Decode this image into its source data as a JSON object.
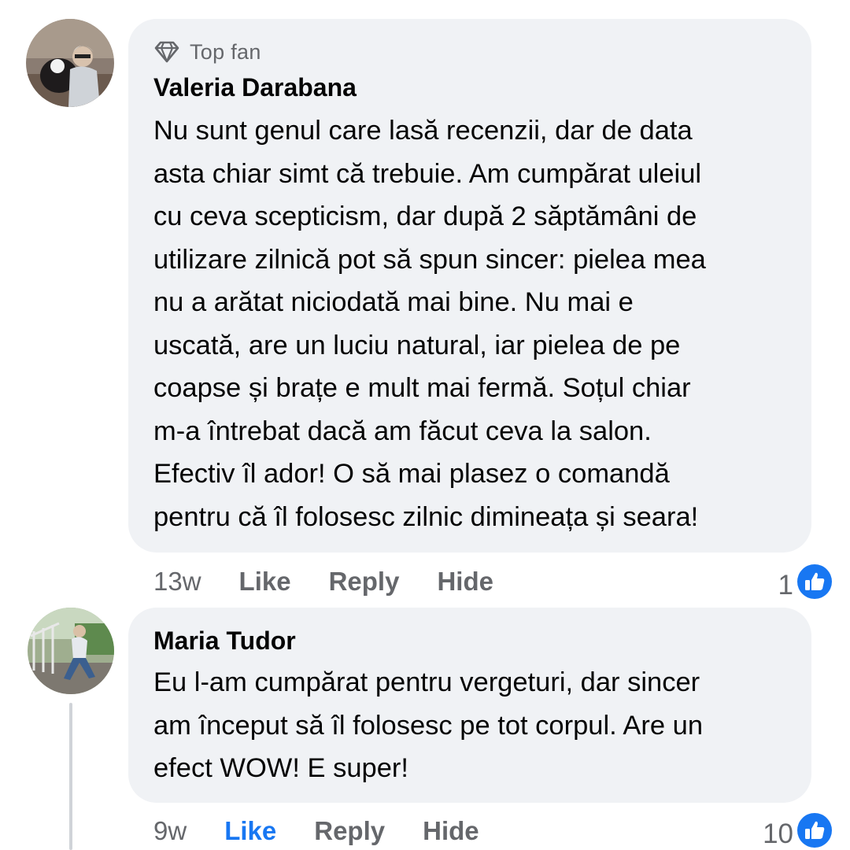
{
  "comments": [
    {
      "badge": "Top fan",
      "author": "Valeria Darabana",
      "text": "Nu sunt genul care lasă recenzii, dar de data\nasta chiar simt că trebuie. Am cumpărat uleiul\ncu ceva scepticism, dar după 2 săptămâni de\nutilizare zilnică pot să spun sincer: pielea mea\nnu a arătat niciodată mai bine. Nu mai e\nuscată, are un luciu natural, iar pielea de pe\ncoapse și brațe e mult mai fermă. Soțul chiar\nm-a întrebat dacă am făcut ceva la salon.\nEfectiv îl ador! O să mai plasez o comandă\npentru că îl folosesc zilnic dimineața și seara!",
      "time": "13w",
      "like_label": "Like",
      "reply_label": "Reply",
      "hide_label": "Hide",
      "reaction_count": "1"
    },
    {
      "author": "Maria Tudor",
      "text": "Eu l-am cumpărat pentru vergeturi, dar sincer\nam început să îl folosesc pe tot corpul. Are un\nefect WOW! E super!",
      "time": "9w",
      "like_label": "Like",
      "reply_label": "Reply",
      "hide_label": "Hide",
      "reaction_count": "10",
      "liked": true
    }
  ],
  "colors": {
    "bubble": "#f0f2f5",
    "muted_text": "#65676b",
    "like_blue": "#1877f2"
  },
  "icons": {
    "badge": "diamond-icon",
    "reaction": "thumbs-up-icon"
  }
}
